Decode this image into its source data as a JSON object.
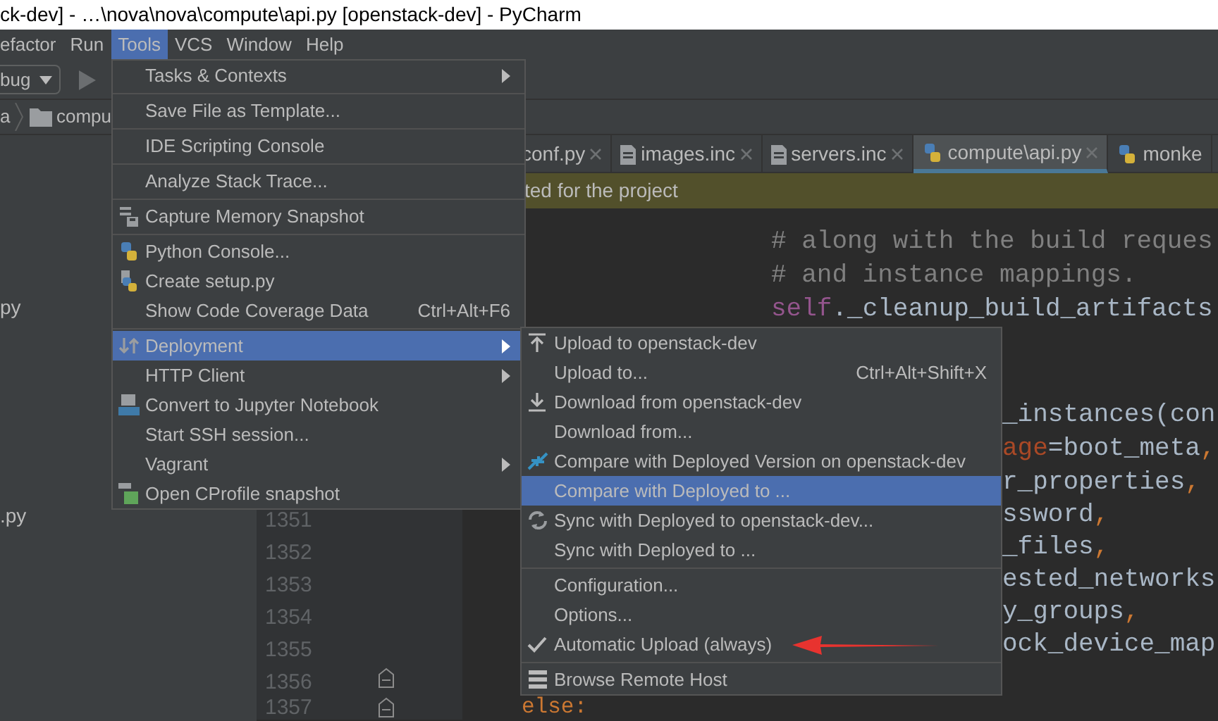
{
  "window": {
    "title": "ck-dev] - …\\nova\\nova\\compute\\api.py [openstack-dev] - PyCharm"
  },
  "menu_bar": [
    {
      "label": "efactor",
      "selected": false
    },
    {
      "label": "Run",
      "selected": false
    },
    {
      "label": "Tools",
      "selected": true
    },
    {
      "label": "VCS",
      "selected": false
    },
    {
      "label": "Window",
      "selected": false
    },
    {
      "label": "Help",
      "selected": false
    }
  ],
  "toolbar": {
    "configuration": "bug"
  },
  "breadcrumb": [
    "a",
    "compu"
  ],
  "project_tree": [
    {
      "label": "py"
    },
    {
      "label": ".py"
    }
  ],
  "tabs": [
    {
      "label": "conf.py",
      "kind": "cut",
      "selected": false,
      "closable": true
    },
    {
      "label": "images.inc",
      "kind": "file",
      "selected": false,
      "closable": true
    },
    {
      "label": "servers.inc",
      "kind": "file",
      "selected": false,
      "closable": true
    },
    {
      "label": "compute\\api.py",
      "kind": "python",
      "selected": true,
      "closable": true
    },
    {
      "label": "monke",
      "kind": "python",
      "selected": false,
      "closable": false
    }
  ],
  "banner": "ted for the project",
  "editor_lines": [
    {
      "kind": "deep",
      "tokens": [
        {
          "text": "# along with the build reques",
          "kind": "comment"
        }
      ]
    },
    {
      "kind": "deep",
      "tokens": [
        {
          "text": "# and instance mappings.",
          "kind": "comment"
        }
      ]
    },
    {
      "kind": "deep",
      "tokens": [
        {
          "text": "self",
          "kind": "self"
        },
        {
          "text": "._cleanup_build_artifacts",
          "kind": "plain"
        }
      ]
    },
    {
      "kind": "empty"
    },
    {
      "kind": "empty"
    },
    {
      "kind": "cut",
      "tokens": [
        {
          "text": "_instances(con",
          "kind": "plain"
        }
      ]
    },
    {
      "kind": "cut",
      "tokens": [
        {
          "text": "age",
          "kind": "param"
        },
        {
          "text": "=boot_meta",
          "kind": "plain"
        },
        {
          "text": ",",
          "kind": "keyword"
        }
      ]
    },
    {
      "kind": "cut",
      "tokens": [
        {
          "text": "r_properties",
          "kind": "plain"
        },
        {
          "text": ",",
          "kind": "keyword"
        }
      ]
    },
    {
      "kind": "cut",
      "number": "1351",
      "tokens": [
        {
          "text": "ssword",
          "kind": "plain"
        },
        {
          "text": ",",
          "kind": "keyword"
        }
      ]
    },
    {
      "kind": "cut",
      "number": "1352",
      "tokens": [
        {
          "text": "_files",
          "kind": "plain"
        },
        {
          "text": ",",
          "kind": "keyword"
        }
      ]
    },
    {
      "kind": "cut",
      "number": "1353",
      "tokens": [
        {
          "text": "ested_networks",
          "kind": "plain"
        }
      ]
    },
    {
      "kind": "cut",
      "number": "1354",
      "tokens": [
        {
          "text": "y_groups",
          "kind": "plain"
        },
        {
          "text": ",",
          "kind": "keyword"
        }
      ]
    },
    {
      "kind": "cut",
      "number": "1355",
      "tokens": [
        {
          "text": "ock_device_map",
          "kind": "plain"
        }
      ]
    },
    {
      "kind": "empty",
      "number": "1356",
      "fold": true
    },
    {
      "kind": "base",
      "number": "1357",
      "fold": true,
      "tokens": [
        {
          "text": "else",
          "kind": "keyword"
        },
        {
          "text": ":",
          "kind": "keyword"
        }
      ]
    }
  ],
  "tools_menu": {
    "groups": [
      [
        {
          "label": "Tasks & Contexts",
          "submenu": true,
          "selected": false
        }
      ],
      [
        {
          "label": "Save File as Template...",
          "submenu": false,
          "selected": false
        }
      ],
      [
        {
          "label": "IDE Scripting Console",
          "submenu": false,
          "selected": false
        }
      ],
      [
        {
          "label": "Analyze Stack Trace...",
          "submenu": false,
          "selected": false
        }
      ],
      [
        {
          "label": "Capture Memory Snapshot",
          "submenu": false,
          "selected": false
        }
      ],
      [
        {
          "label": "Python Console...",
          "submenu": false,
          "selected": false
        },
        {
          "label": "Create setup.py",
          "submenu": false,
          "selected": false
        },
        {
          "label": "Show Code Coverage Data",
          "shortcut": "Ctrl+Alt+F6",
          "submenu": false,
          "selected": false
        }
      ],
      [
        {
          "label": "Deployment",
          "submenu": true,
          "selected": true
        },
        {
          "label": "HTTP Client",
          "submenu": true,
          "selected": false
        },
        {
          "label": "Convert to Jupyter Notebook",
          "submenu": false,
          "selected": false
        },
        {
          "label": "Start SSH session...",
          "submenu": false,
          "selected": false
        },
        {
          "label": "Vagrant",
          "submenu": true,
          "selected": false
        },
        {
          "label": "Open CProfile snapshot",
          "submenu": false,
          "selected": false
        }
      ]
    ]
  },
  "deployment_menu": {
    "groups": [
      [
        {
          "label": "Upload to openstack-dev",
          "selected": false,
          "checked": false
        },
        {
          "label": "Upload to...",
          "shortcut": "Ctrl+Alt+Shift+X",
          "selected": false,
          "checked": false
        },
        {
          "label": "Download from openstack-dev",
          "selected": false,
          "checked": false
        },
        {
          "label": "Download from...",
          "selected": false,
          "checked": false
        },
        {
          "label": "Compare with Deployed Version on openstack-dev",
          "selected": false,
          "checked": false
        },
        {
          "label": "Compare with Deployed to ...",
          "selected": true,
          "checked": false
        },
        {
          "label": "Sync with Deployed to openstack-dev...",
          "selected": false,
          "checked": false
        },
        {
          "label": "Sync with Deployed to ...",
          "selected": false,
          "checked": false
        }
      ],
      [
        {
          "label": "Configuration...",
          "selected": false,
          "checked": false
        },
        {
          "label": "Options...",
          "selected": false,
          "checked": false
        },
        {
          "label": "Automatic Upload (always)",
          "selected": false,
          "checked": true
        }
      ],
      [
        {
          "label": "Browse Remote Host",
          "selected": false,
          "checked": false
        }
      ]
    ]
  }
}
